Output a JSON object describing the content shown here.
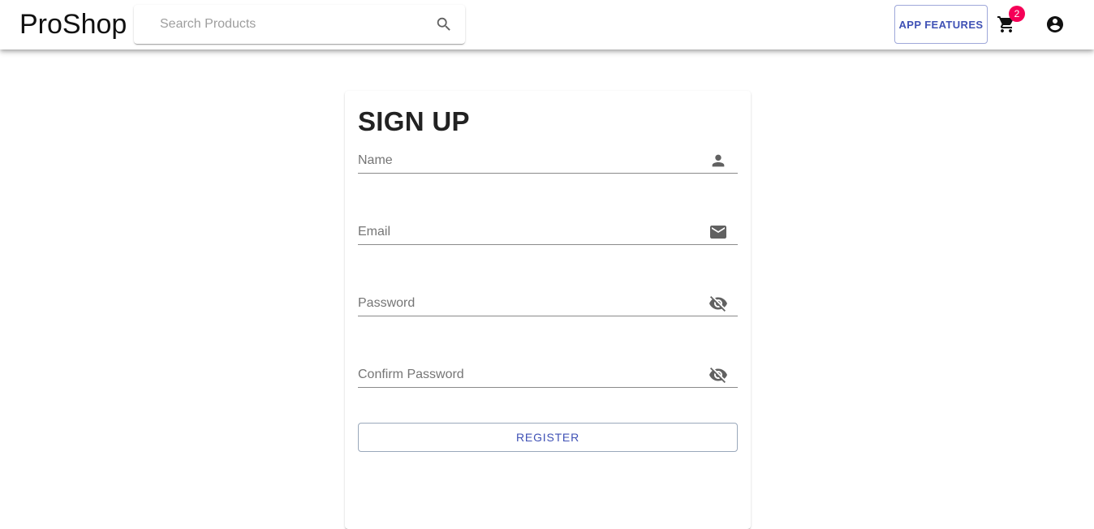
{
  "header": {
    "brand": "ProShop",
    "search": {
      "placeholder": "Search Products",
      "value": ""
    },
    "features_label": "APP FEATURES",
    "cart_count": "2",
    "accent_color": "#3f51b5",
    "badge_color": "#f50057"
  },
  "icons": {
    "search": "search-icon",
    "cart": "shopping-cart-icon",
    "account": "account-circle-icon",
    "name": "person-icon",
    "email": "mail-icon",
    "password": "visibility-off-icon"
  },
  "form": {
    "title": "SIGN UP",
    "name": {
      "placeholder": "Name",
      "value": ""
    },
    "email": {
      "placeholder": "Email",
      "value": ""
    },
    "password": {
      "placeholder": "Password",
      "value": ""
    },
    "confirm_password": {
      "placeholder": "Confirm Password",
      "value": ""
    },
    "register_label": "REGISTER"
  }
}
